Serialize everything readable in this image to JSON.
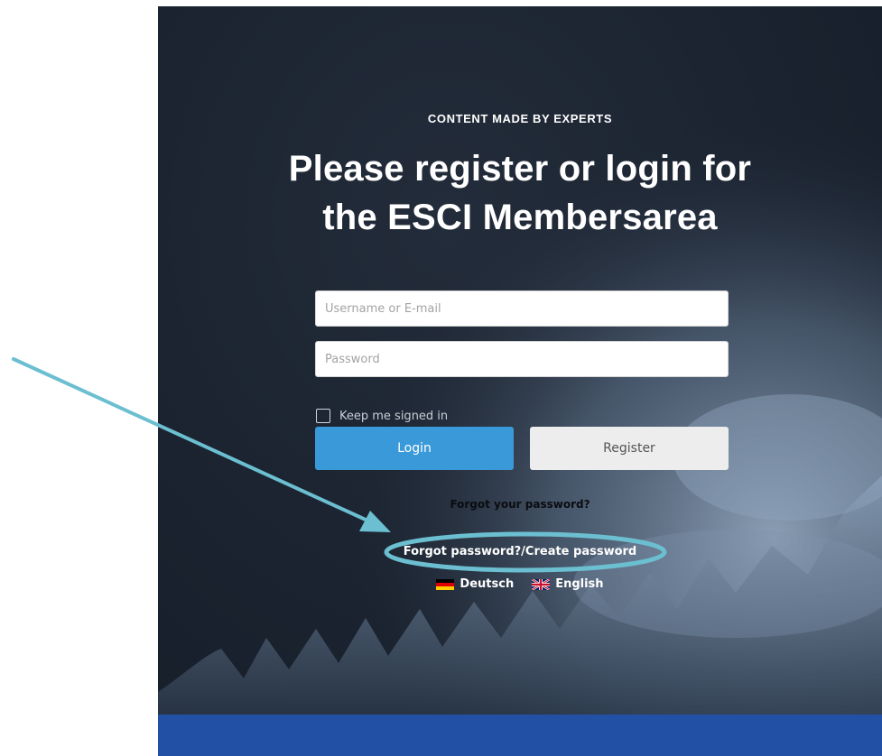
{
  "hero": {
    "eyebrow": "CONTENT MADE BY EXPERTS",
    "headline_line1": "Please register or login for",
    "headline_line2": "the ESCI Membersarea"
  },
  "form": {
    "username_placeholder": "Username or E-mail",
    "password_placeholder": "Password",
    "keep_signed_in_label": "Keep me signed in",
    "login_label": "Login",
    "register_label": "Register"
  },
  "links": {
    "forgot_password": "Forgot your password?",
    "forgot_create_password": "Forgot password?/Create password"
  },
  "languages": [
    {
      "label": "Deutsch",
      "flag": "germany-flag-icon"
    },
    {
      "label": "English",
      "flag": "uk-flag-icon"
    }
  ],
  "colors": {
    "hero_background": "#1b2330",
    "login_button": "#3a9ad9",
    "register_button": "#ededed",
    "footer_band": "#2250a4",
    "annotation": "#6bbfd0"
  }
}
